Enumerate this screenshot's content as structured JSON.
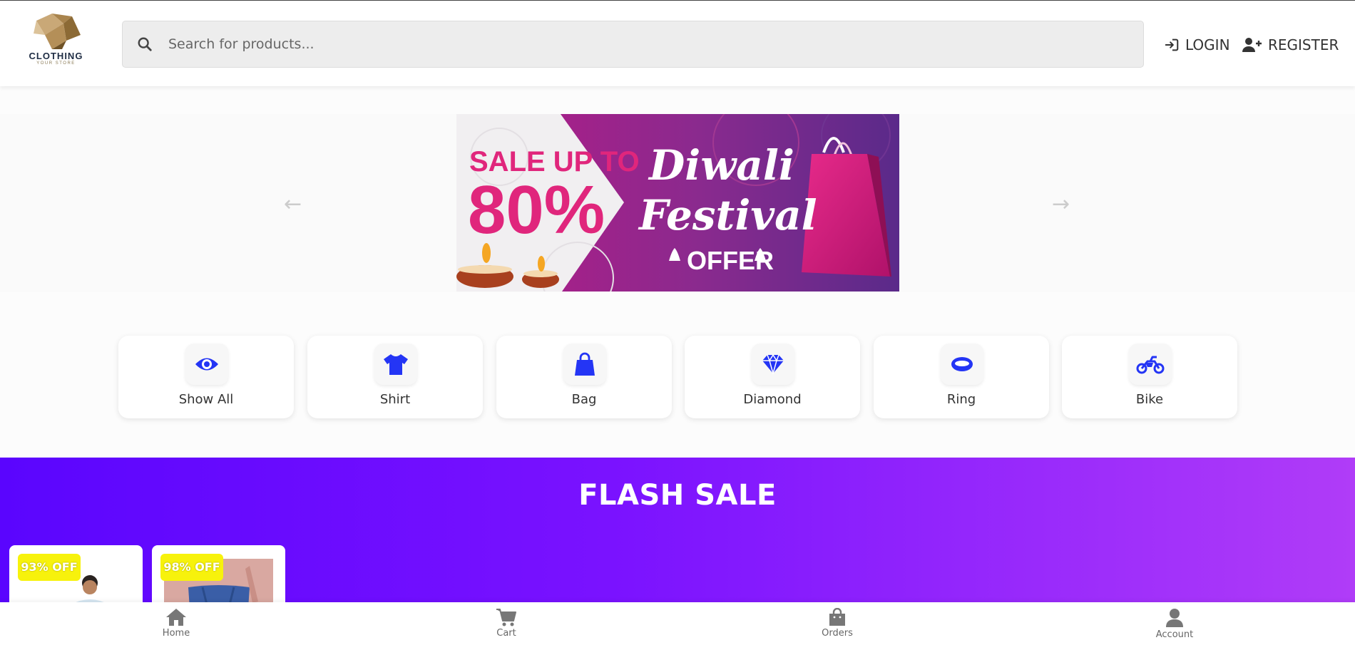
{
  "header": {
    "logo_text": "CLOTHING",
    "logo_subtext": "YOUR STORE",
    "search_placeholder": "Search for products...",
    "login_label": "LOGIN",
    "register_label": "REGISTER"
  },
  "banner": {
    "prev_arrow": "←",
    "next_arrow": "→",
    "sale_line1": "SALE UP TO",
    "sale_line2": "80%",
    "festival_line1": "Diwali",
    "festival_line2": "Festival",
    "offer_text": "OFFER"
  },
  "categories": [
    {
      "label": "Show All",
      "icon": "eye-icon"
    },
    {
      "label": "Shirt",
      "icon": "shirt-icon"
    },
    {
      "label": "Bag",
      "icon": "bag-icon"
    },
    {
      "label": "Diamond",
      "icon": "diamond-icon"
    },
    {
      "label": "Ring",
      "icon": "ring-icon"
    },
    {
      "label": "Bike",
      "icon": "motorcycle-icon"
    }
  ],
  "flash_sale": {
    "title": "FLASH SALE",
    "products": [
      {
        "badge": "93% OFF"
      },
      {
        "badge": "98% OFF"
      }
    ]
  },
  "bottom_nav": {
    "items": [
      {
        "label": "Home",
        "icon": "home-icon"
      },
      {
        "label": "Cart",
        "icon": "cart-icon"
      },
      {
        "label": "Orders",
        "icon": "shopping-bag-icon"
      },
      {
        "label": "Account",
        "icon": "user-icon"
      }
    ]
  },
  "colors": {
    "accent_blue": "#2435f5",
    "flash_gradient_start": "#5a05fe",
    "flash_gradient_end": "#b03cf8",
    "badge_yellow": "#f7f20c",
    "banner_pink": "#e0267c"
  }
}
